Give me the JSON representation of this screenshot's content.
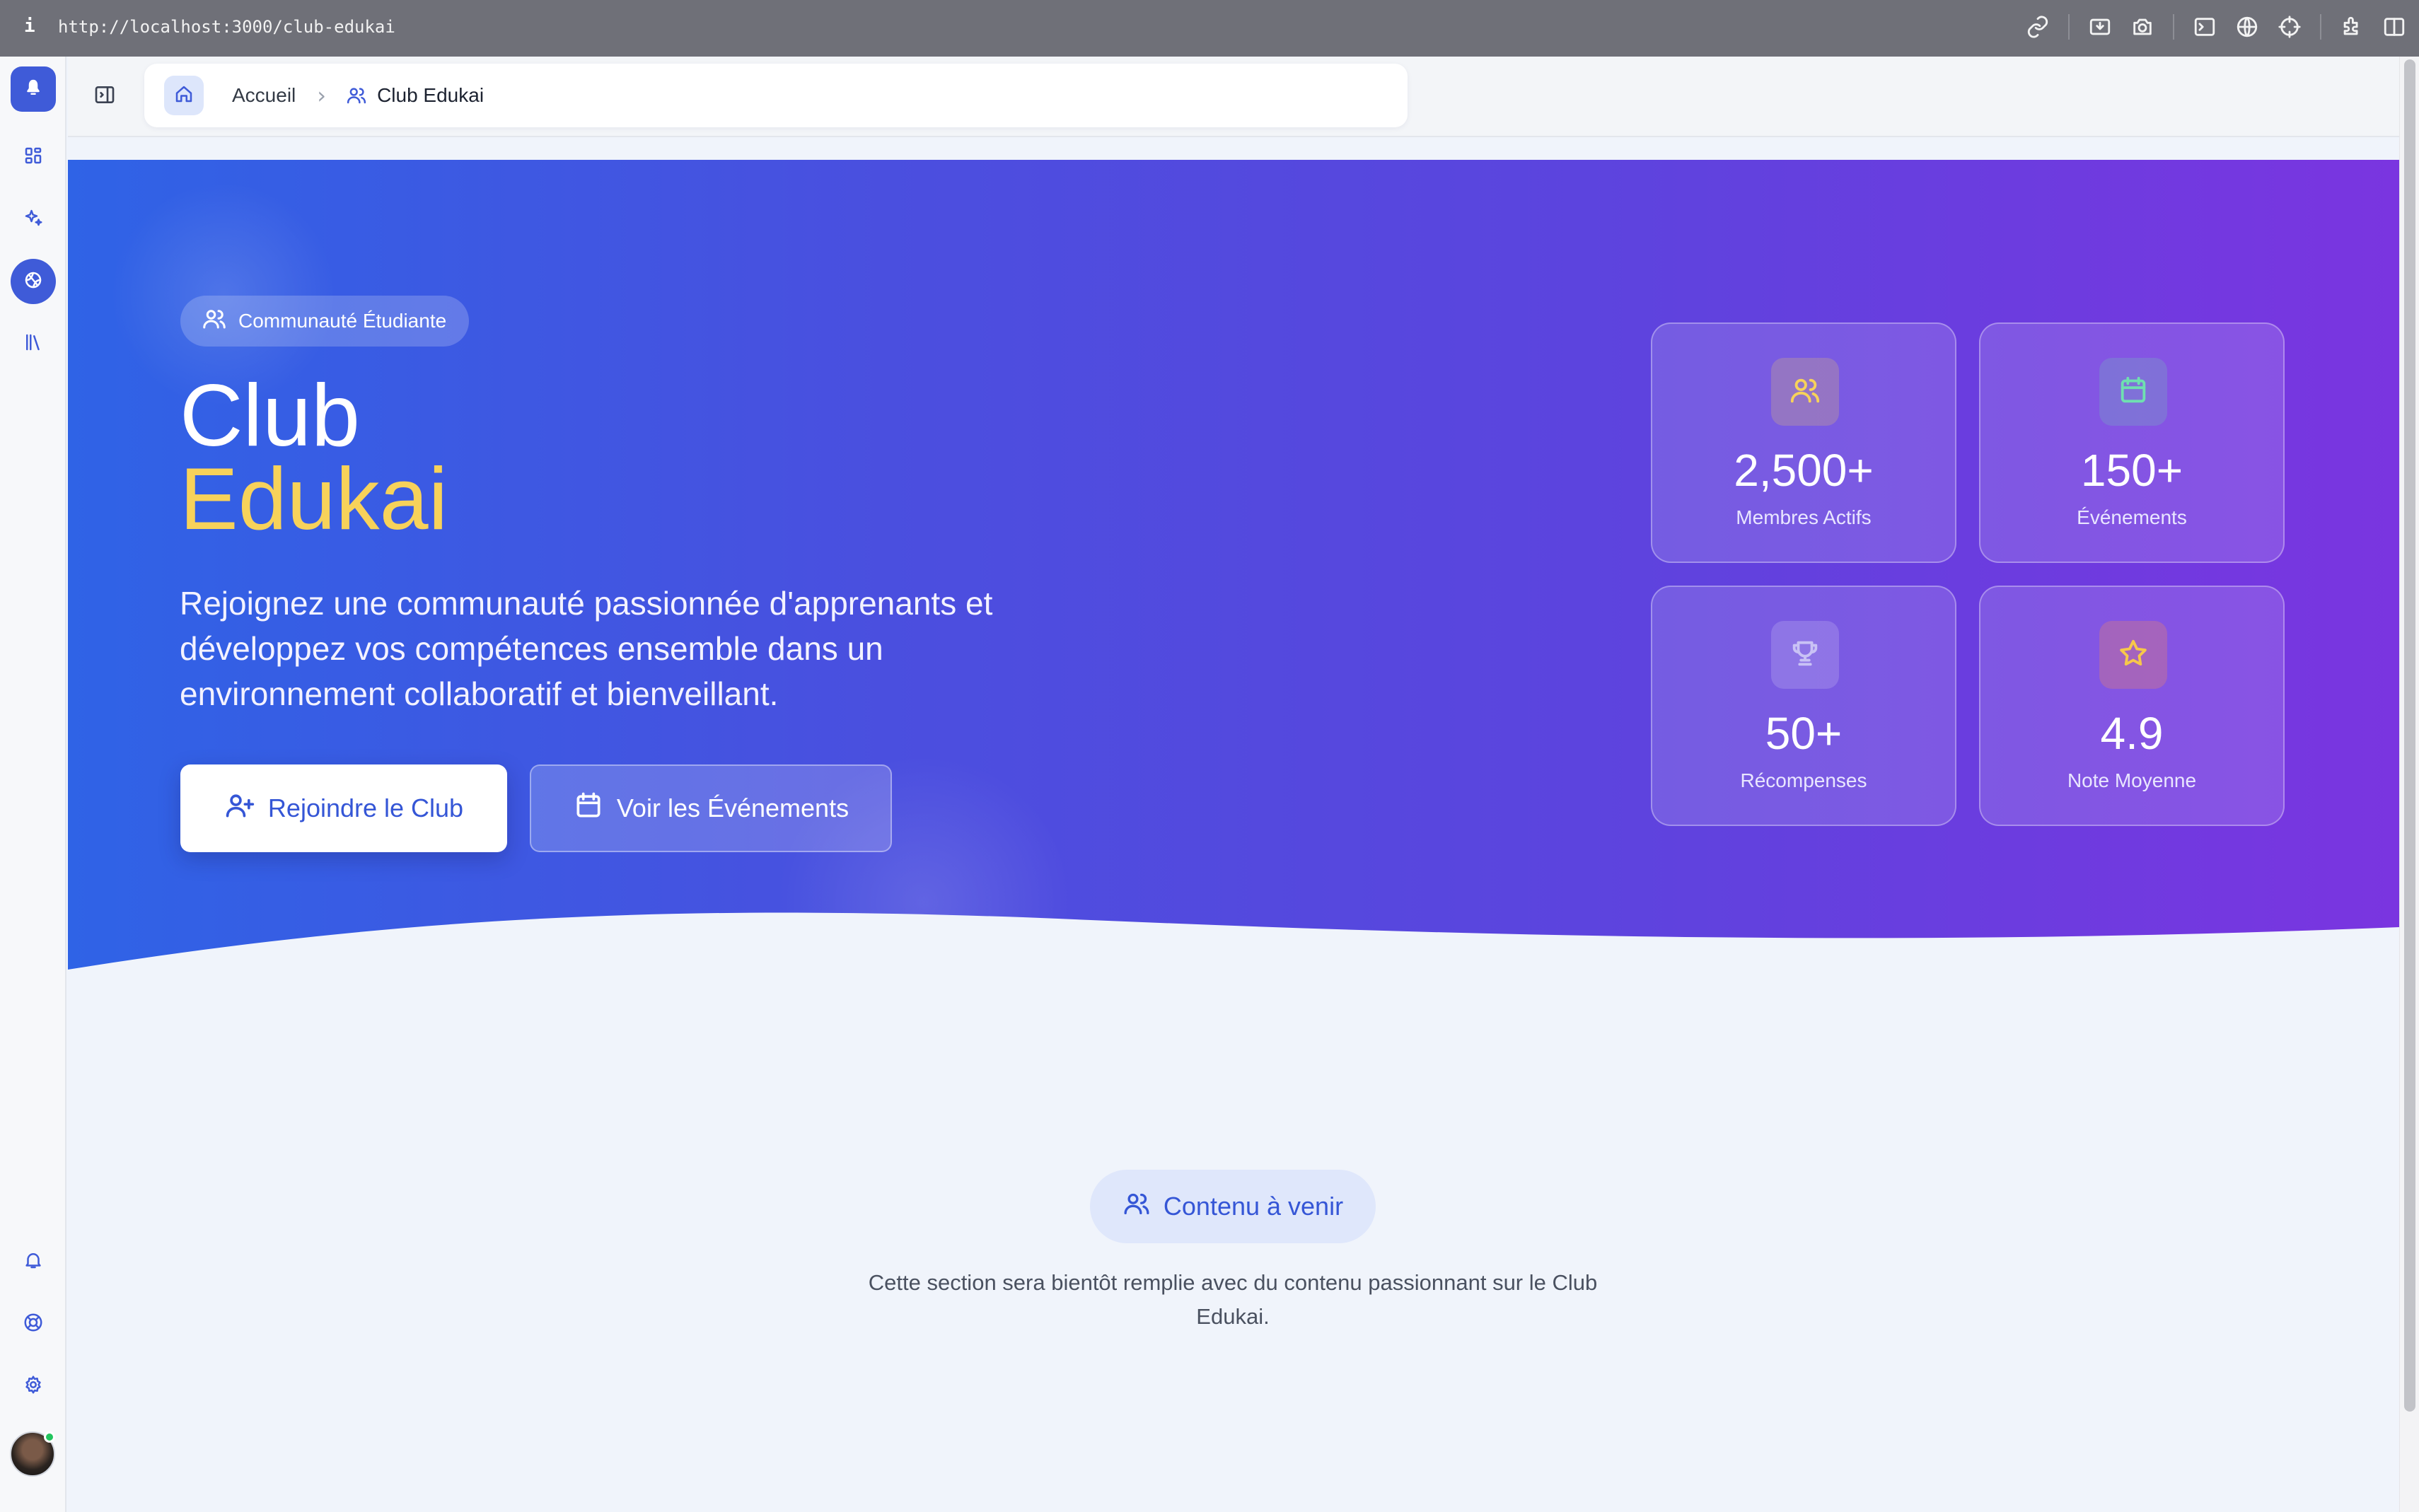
{
  "browser": {
    "info_icon": "i",
    "url": "http://localhost:3000/club-edukai",
    "tools": [
      "link-icon",
      "install-icon",
      "camera-icon",
      "terminal-icon",
      "globe-icon",
      "crosshair-icon",
      "extensions-icon",
      "split-view-icon"
    ]
  },
  "sidebar": {
    "items": [
      "logo-icon",
      "dashboard-icon",
      "sparkles-icon",
      "club-icon",
      "library-icon"
    ],
    "bottom": [
      "bell-icon",
      "help-icon",
      "settings-icon"
    ]
  },
  "breadcrumb": {
    "home": "Accueil",
    "current": "Club Edukai"
  },
  "hero": {
    "badge": "Communauté Étudiante",
    "title_line1": "Club",
    "title_line2": "Edukai",
    "lead": "Rejoignez une communauté passionnée d'apprenants et développez vos compétences ensemble dans un environnement collaboratif et bienveillant.",
    "primary_button": "Rejoindre le Club",
    "secondary_button": "Voir les Événements",
    "stats": [
      {
        "value": "2,500+",
        "label": "Membres Actifs",
        "icon": "users-icon",
        "color": "#f7d25a"
      },
      {
        "value": "150+",
        "label": "Événements",
        "icon": "calendar-icon",
        "color": "#6fe0b0"
      },
      {
        "value": "50+",
        "label": "Récompenses",
        "icon": "trophy-icon",
        "color": "#c9c2f5"
      },
      {
        "value": "4.9",
        "label": "Note Moyenne",
        "icon": "star-icon",
        "color": "#f7c74a"
      }
    ]
  },
  "section": {
    "pill": "Contenu à venir",
    "description": "Cette section sera bientôt remplie avec du contenu passionnant sur le Club Edukai."
  },
  "colors": {
    "accent": "#3f5bd8",
    "gradient_start": "#2f63e6",
    "gradient_end": "#7a35e0",
    "highlight": "#f7d25a"
  }
}
